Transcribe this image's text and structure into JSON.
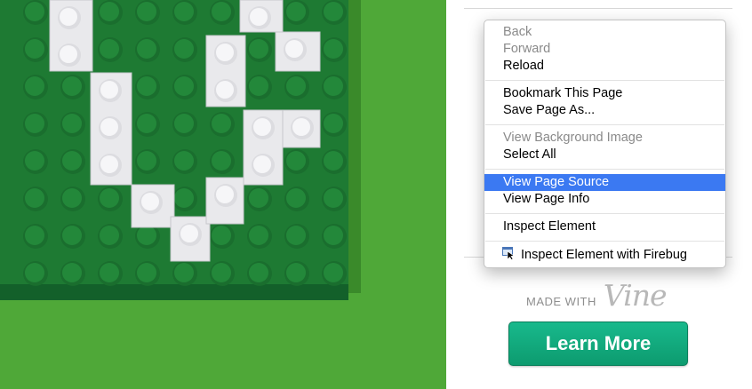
{
  "context_menu": {
    "items": [
      {
        "label": "Back",
        "disabled": true
      },
      {
        "label": "Forward",
        "disabled": true
      },
      {
        "label": "Reload",
        "disabled": false
      },
      {
        "label": "Bookmark This Page",
        "disabled": false
      },
      {
        "label": "Save Page As...",
        "disabled": false
      },
      {
        "label": "View Background Image",
        "disabled": true
      },
      {
        "label": "Select All",
        "disabled": false
      },
      {
        "label": "View Page Source",
        "disabled": false,
        "selected": true
      },
      {
        "label": "View Page Info",
        "disabled": false
      },
      {
        "label": "Inspect Element",
        "disabled": false
      },
      {
        "label": "Inspect Element with Firebug",
        "disabled": false,
        "icon": "firebug-inspect-icon"
      }
    ]
  },
  "footer": {
    "made_with": "MADE WITH",
    "brand": "Vine",
    "learn_more": "Learn More"
  },
  "colors": {
    "selection": "#3b79f2",
    "button": "#0d9b6f",
    "lego_green": "#1f7a34",
    "backdrop_green": "#4fa838"
  }
}
